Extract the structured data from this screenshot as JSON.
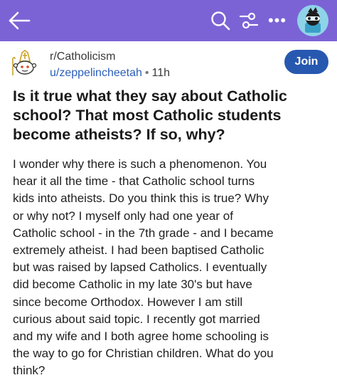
{
  "colors": {
    "top_bar": "#7b63d6",
    "join_button": "#2758b0",
    "author_link": "#2b5fb8"
  },
  "top_bar": {
    "icons": [
      "back-arrow-icon",
      "search-icon",
      "filter-icon",
      "more-icon",
      "avatar-icon"
    ],
    "more_label": "•••"
  },
  "post": {
    "subreddit": "r/Catholicism",
    "author": "u/zeppelincheetah",
    "separator": "•",
    "age": "11h",
    "join_label": "Join",
    "title": "Is it true what they say about Catholic school? That most Catholic students become atheists? If so, why?",
    "body": "I wonder why there is such a phenomenon.  You\nhear it all the time - that Catholic school turns\nkids into atheists.  Do you think this is true?  Why\nor why not?  I myself only had one year of\nCatholic school - in the 7th grade - and I became\nextremely atheist.  I had been baptised Catholic\nbut was raised by lapsed Catholics.  I eventually\ndid become Catholic in my late 30's but have\nsince become Orthodox.  However I am still\ncurious about said topic.  I recently got married\nand my wife and I both agree home schooling is\nthe way to go for Christian children.  What do you\nthink?"
  }
}
